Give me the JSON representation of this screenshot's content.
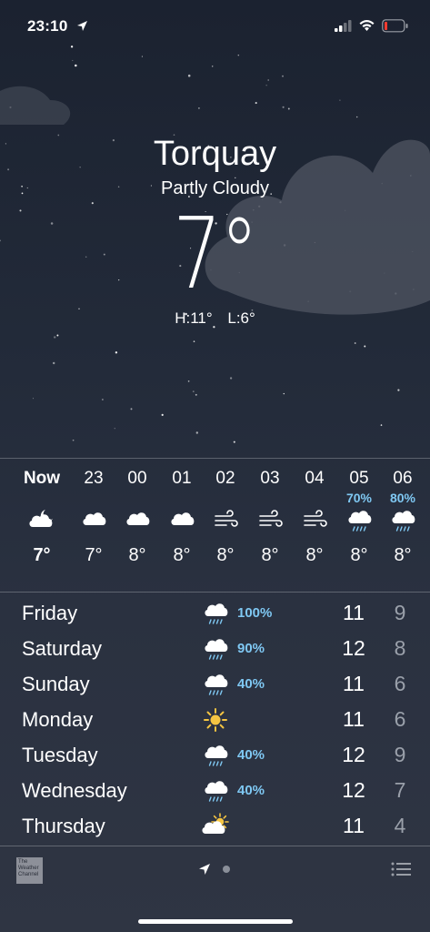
{
  "status": {
    "time": "23:10"
  },
  "location": {
    "city": "Torquay",
    "condition": "Partly Cloudy",
    "temperature": "7°",
    "high": "H:11°",
    "low": "L:6°"
  },
  "hourly": [
    {
      "label": "Now",
      "pop": "",
      "icon": "partly-cloudy-night-icon",
      "temp": "7°"
    },
    {
      "label": "23",
      "pop": "",
      "icon": "cloud-icon",
      "temp": "7°"
    },
    {
      "label": "00",
      "pop": "",
      "icon": "cloud-icon",
      "temp": "8°"
    },
    {
      "label": "01",
      "pop": "",
      "icon": "cloud-icon",
      "temp": "8°"
    },
    {
      "label": "02",
      "pop": "",
      "icon": "wind-icon",
      "temp": "8°"
    },
    {
      "label": "03",
      "pop": "",
      "icon": "wind-icon",
      "temp": "8°"
    },
    {
      "label": "04",
      "pop": "",
      "icon": "wind-icon",
      "temp": "8°"
    },
    {
      "label": "05",
      "pop": "70%",
      "icon": "rain-cloud-icon",
      "temp": "8°"
    },
    {
      "label": "06",
      "pop": "80%",
      "icon": "rain-cloud-icon",
      "temp": "8°"
    }
  ],
  "daily": [
    {
      "day": "Friday",
      "icon": "rain-cloud-icon",
      "pop": "100%",
      "hi": "11",
      "lo": "9"
    },
    {
      "day": "Saturday",
      "icon": "rain-cloud-icon",
      "pop": "90%",
      "hi": "12",
      "lo": "8"
    },
    {
      "day": "Sunday",
      "icon": "rain-cloud-icon",
      "pop": "40%",
      "hi": "11",
      "lo": "6"
    },
    {
      "day": "Monday",
      "icon": "sun-icon",
      "pop": "",
      "hi": "11",
      "lo": "6"
    },
    {
      "day": "Tuesday",
      "icon": "rain-cloud-icon",
      "pop": "40%",
      "hi": "12",
      "lo": "9"
    },
    {
      "day": "Wednesday",
      "icon": "rain-cloud-icon",
      "pop": "40%",
      "hi": "12",
      "lo": "7"
    },
    {
      "day": "Thursday",
      "icon": "partly-sunny-icon",
      "pop": "",
      "hi": "11",
      "lo": "4"
    }
  ],
  "footer": {
    "logo_text": "The Weather Channel"
  },
  "colors": {
    "precip": "#7fc8f3",
    "sun": "#f5c542",
    "low_temp": "#9aa0aa"
  }
}
